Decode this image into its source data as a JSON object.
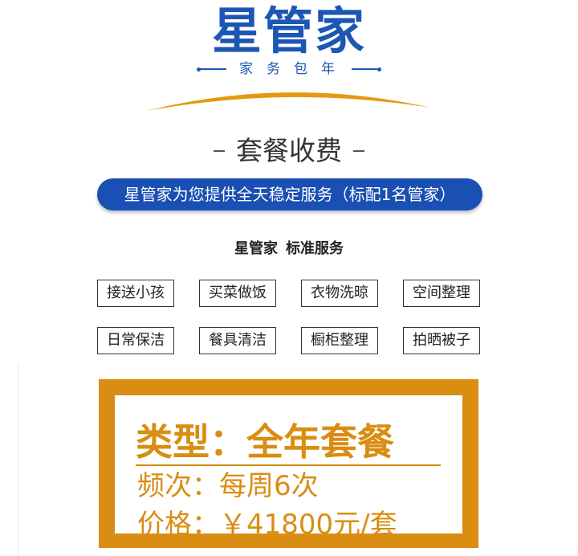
{
  "brand": {
    "name": "星管家",
    "tagline": "家务包年",
    "colors": {
      "primary": "#1d57b5",
      "accent": "#d98d12"
    }
  },
  "section": {
    "heading": "套餐收费",
    "banner": "星管家为您提供全天稳定服务（标配1名管家）"
  },
  "standard": {
    "brand": "星管家",
    "title": "标准服务",
    "items": [
      "接送小孩",
      "买菜做饭",
      "衣物洗晾",
      "空间整理",
      "日常保洁",
      "餐具清洁",
      "橱柜整理",
      "拍晒被子"
    ]
  },
  "package": {
    "type": "类型：全年套餐",
    "frequency": "频次：每周6次",
    "price": "价格：￥41800元/套"
  }
}
